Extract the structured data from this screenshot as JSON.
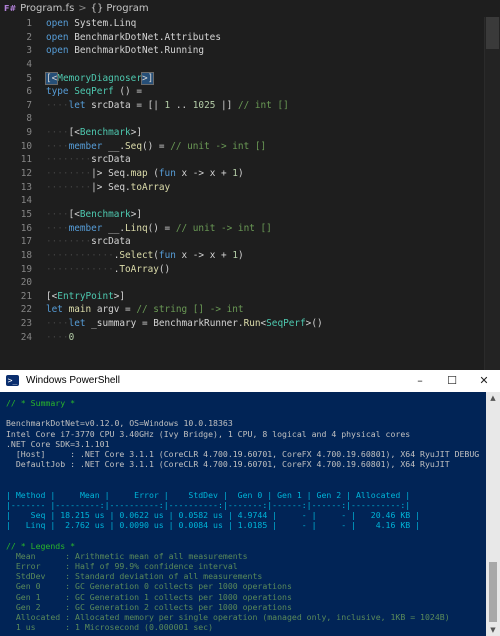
{
  "editor": {
    "breadcrumb": {
      "file_icon": "F#",
      "file": "Program.fs",
      "separator": ">",
      "braces": "{}",
      "symbol": "Program"
    },
    "line_numbers": [
      "1",
      "2",
      "3",
      "4",
      "5",
      "6",
      "7",
      "8",
      "9",
      "10",
      "11",
      "12",
      "13",
      "14",
      "15",
      "16",
      "17",
      "18",
      "19",
      "20",
      "21",
      "22",
      "23",
      "24"
    ]
  },
  "powershell": {
    "title": "Windows PowerShell",
    "icon": "powershell-icon",
    "window_buttons": [
      "–",
      "☐",
      "✕"
    ],
    "lines": [
      {
        "cls": "green",
        "text": "// * Summary *"
      },
      {
        "cls": "gap",
        "text": ""
      },
      {
        "cls": "",
        "text": "BenchmarkDotNet=v0.12.0, OS=Windows 10.0.18363"
      },
      {
        "cls": "",
        "text": "Intel Core i7-3770 CPU 3.40GHz (Ivy Bridge), 1 CPU, 8 logical and 4 physical cores"
      },
      {
        "cls": "",
        "text": ".NET Core SDK=3.1.101"
      },
      {
        "cls": "",
        "text": "  [Host]     : .NET Core 3.1.1 (CoreCLR 4.700.19.60701, CoreFX 4.700.19.60801), X64 RyuJIT DEBUG"
      },
      {
        "cls": "",
        "text": "  DefaultJob : .NET Core 3.1.1 (CoreCLR 4.700.19.60701, CoreFX 4.700.19.60801), X64 RyuJIT"
      },
      {
        "cls": "gap",
        "text": ""
      },
      {
        "cls": "gap",
        "text": ""
      },
      {
        "cls": "cyan",
        "text": "| Method |     Mean |     Error |    StdDev |  Gen 0 | Gen 1 | Gen 2 | Allocated |"
      },
      {
        "cls": "cyan",
        "text": "|------- |---------:|----------:|----------:|-------:|------:|------:|----------:|"
      },
      {
        "cls": "cyan",
        "text": "|    Seq | 18.215 us | 0.0622 us | 0.0582 us | 4.9744 |     - |     - |   20.46 KB |"
      },
      {
        "cls": "cyan",
        "text": "|   Linq |  2.762 us | 0.0090 us | 0.0084 us | 1.0185 |     - |     - |    4.16 KB |"
      },
      {
        "cls": "gap",
        "text": ""
      },
      {
        "cls": "green",
        "text": "// * Legends *"
      },
      {
        "cls": "dim",
        "text": "  Mean      : Arithmetic mean of all measurements"
      },
      {
        "cls": "dim",
        "text": "  Error     : Half of 99.9% confidence interval"
      },
      {
        "cls": "dim",
        "text": "  StdDev    : Standard deviation of all measurements"
      },
      {
        "cls": "dim",
        "text": "  Gen 0     : GC Generation 0 collects per 1000 operations"
      },
      {
        "cls": "dim",
        "text": "  Gen 1     : GC Generation 1 collects per 1000 operations"
      },
      {
        "cls": "dim",
        "text": "  Gen 2     : GC Generation 2 collects per 1000 operations"
      },
      {
        "cls": "dim",
        "text": "  Allocated : Allocated memory per single operation (managed only, inclusive, 1KB = 1024B)"
      },
      {
        "cls": "dim",
        "text": "  1 us      : 1 Microsecond (0.000001 sec)"
      }
    ]
  },
  "colors": {
    "editor_bg": "#1e1e1e",
    "keyword": "#569cd6",
    "type": "#4ec9b0",
    "function": "#dcdcaa",
    "number": "#b5cea8",
    "comment": "#6a9955",
    "ps_bg": "#012456"
  }
}
